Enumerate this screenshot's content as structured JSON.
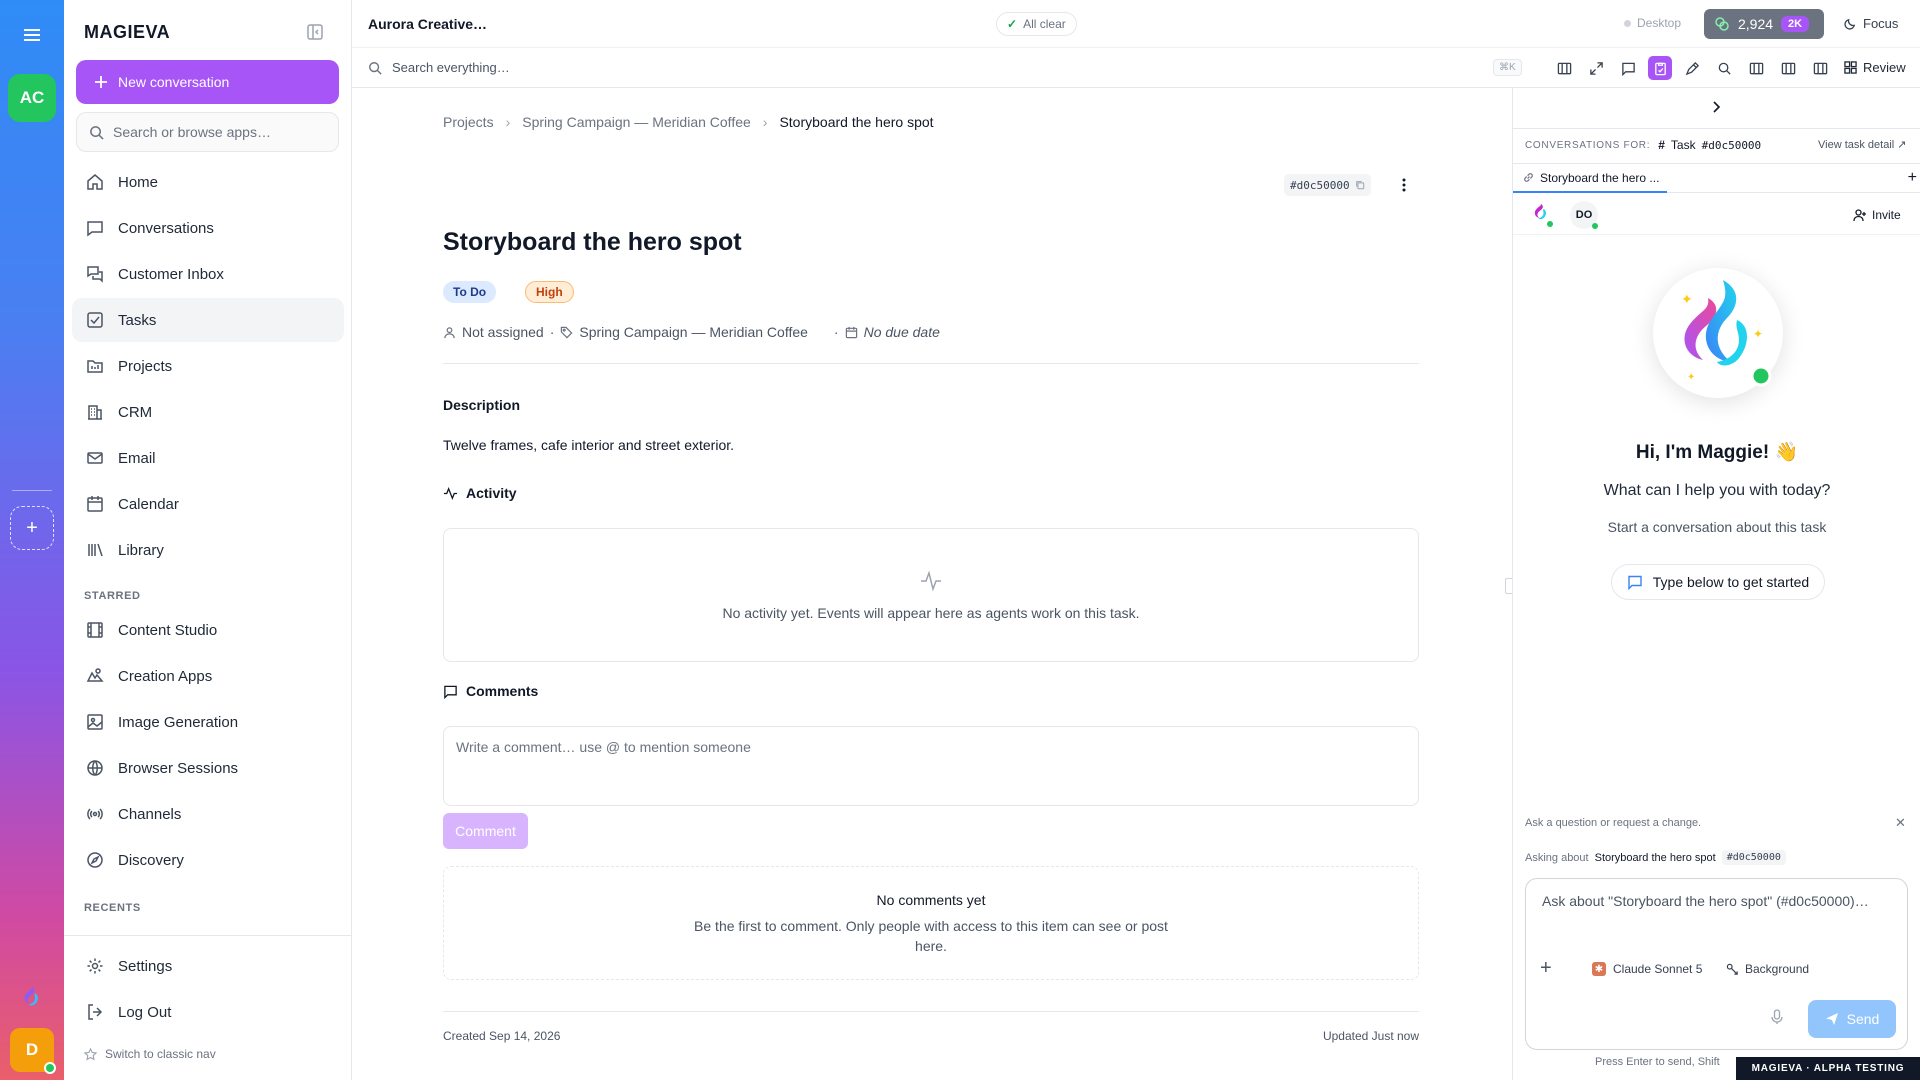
{
  "rail": {
    "workspace_initials": "AC",
    "user_initial": "D"
  },
  "sidebar": {
    "brand": "MAGIEVA",
    "new_conversation": "New conversation",
    "search_placeholder": "Search or browse apps…",
    "nav": [
      {
        "label": "Home",
        "icon": "home-icon"
      },
      {
        "label": "Conversations",
        "icon": "chat-icon"
      },
      {
        "label": "Customer Inbox",
        "icon": "inbox-icon"
      },
      {
        "label": "Tasks",
        "icon": "tasks-icon",
        "active": true
      },
      {
        "label": "Projects",
        "icon": "folder-icon"
      },
      {
        "label": "CRM",
        "icon": "building-icon"
      },
      {
        "label": "Email",
        "icon": "mail-icon"
      },
      {
        "label": "Calendar",
        "icon": "calendar-icon"
      },
      {
        "label": "Library",
        "icon": "library-icon"
      }
    ],
    "starred_heading": "STARRED",
    "starred": [
      {
        "label": "Content Studio",
        "icon": "film-icon"
      },
      {
        "label": "Creation Apps",
        "icon": "apps-icon"
      },
      {
        "label": "Image Generation",
        "icon": "image-icon"
      },
      {
        "label": "Browser Sessions",
        "icon": "globe-icon"
      },
      {
        "label": "Channels",
        "icon": "broadcast-icon"
      },
      {
        "label": "Discovery",
        "icon": "compass-icon"
      }
    ],
    "recents_heading": "RECENTS",
    "settings": "Settings",
    "logout": "Log Out",
    "switch_nav": "Switch to classic nav"
  },
  "topbar": {
    "title": "Aurora Creative…",
    "status": "All clear",
    "device": "Desktop",
    "credits": "2,924",
    "credits_badge": "2K",
    "focus": "Focus"
  },
  "toolbar": {
    "search_placeholder": "Search everything…",
    "shortcut": "⌘K",
    "review": "Review"
  },
  "task": {
    "breadcrumb": [
      "Projects",
      "Spring Campaign — Meridian Coffee",
      "Storyboard the hero spot"
    ],
    "id": "#d0c50000",
    "title": "Storyboard the hero spot",
    "status": "To Do",
    "priority": "High",
    "assignee": "Not assigned",
    "project": "Spring Campaign — Meridian Coffee",
    "due": "No due date",
    "description_label": "Description",
    "description": "Twelve frames, cafe interior and street exterior.",
    "activity_label": "Activity",
    "activity_empty": "No activity yet. Events will appear here as agents work on this task.",
    "comments_label": "Comments",
    "comment_placeholder": "Write a comment… use @ to mention someone",
    "comment_button": "Comment",
    "no_comments_title": "No comments yet",
    "no_comments_body": "Be the first to comment. Only people with access to this item can see or post here.",
    "created": "Created Sep 14, 2026",
    "updated": "Updated Just now"
  },
  "panel": {
    "conversations_for": "CONVERSATIONS FOR:",
    "task_word": "Task",
    "task_id": "#d0c50000",
    "view_task_detail": "View task detail",
    "tab_label": "Storyboard the hero ...",
    "user_initials": "DO",
    "invite": "Invite",
    "greeting": "Hi, I'm Maggie! 👋",
    "help": "What can I help you with today?",
    "start": "Start a conversation about this task",
    "type_below": "Type below to get started",
    "ask_hint": "Ask a question or request a change.",
    "asking_about_label": "Asking about",
    "asking_about_title": "Storyboard the hero spot",
    "asking_about_id": "#d0c50000",
    "composer_placeholder": "Ask about \"Storyboard the hero spot\" (#d0c50000)…",
    "model": "Claude Sonnet 5",
    "background": "Background",
    "send": "Send",
    "enter_hint": "Press Enter to send, Shift"
  },
  "footer_badge": "MAGIEVA · ALPHA TESTING",
  "colors": {
    "accent": "#a855f7",
    "success": "#22c55e",
    "send": "#93c5fd"
  }
}
